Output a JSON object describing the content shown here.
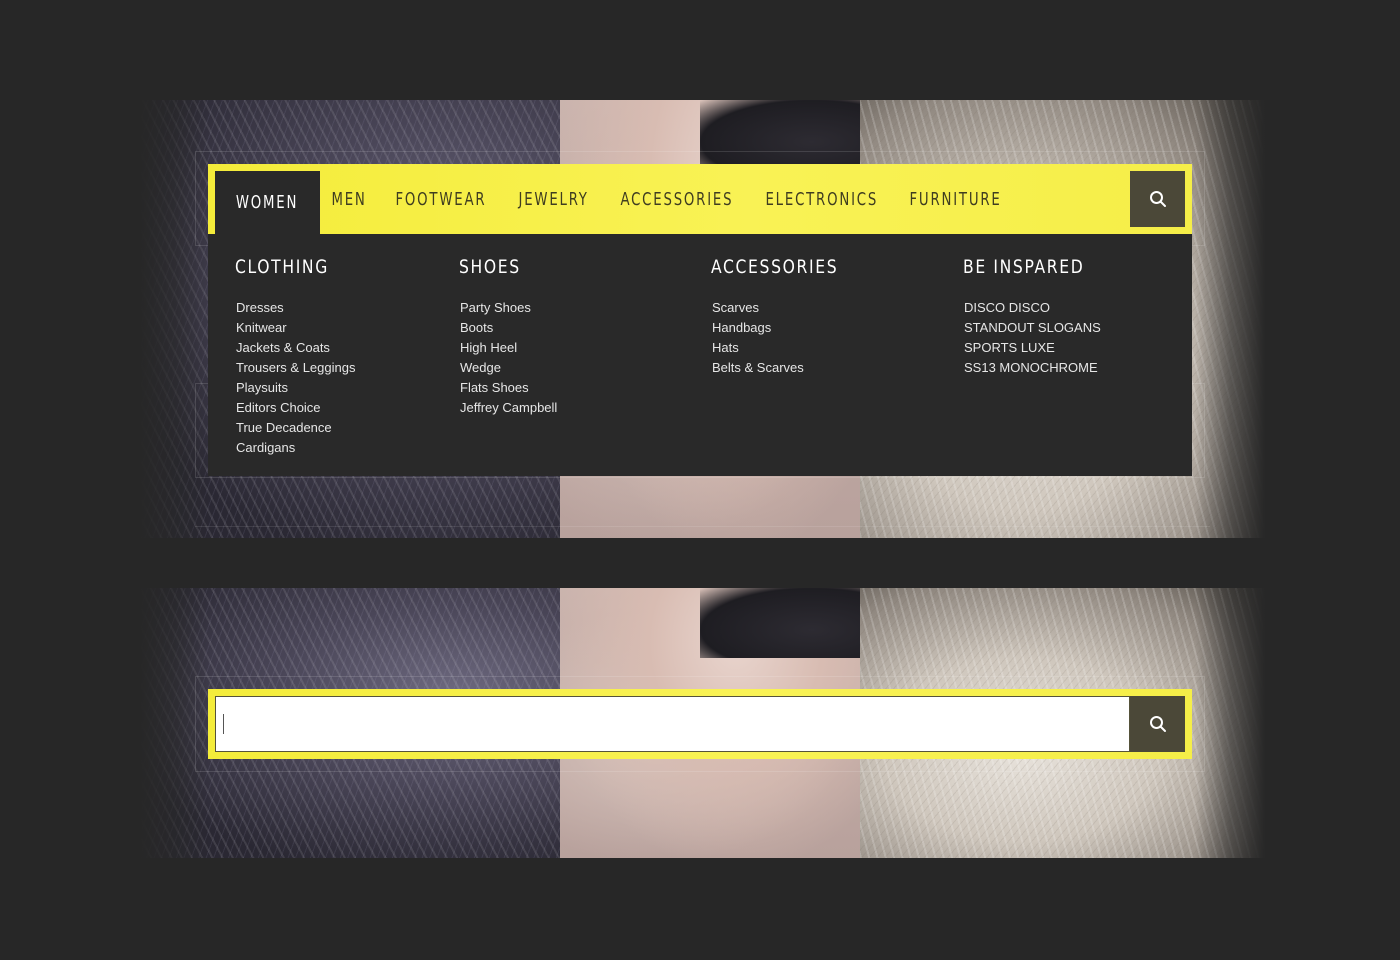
{
  "nav": {
    "items": [
      {
        "label": "WOMEN",
        "active": true
      },
      {
        "label": "MEN",
        "active": false
      },
      {
        "label": "FOOTWEAR",
        "active": false
      },
      {
        "label": "JEWELRY",
        "active": false
      },
      {
        "label": "ACCESSORIES",
        "active": false
      },
      {
        "label": "ELECTRONICS",
        "active": false
      },
      {
        "label": "FURNITURE",
        "active": false
      }
    ],
    "search_icon": "search-icon"
  },
  "dropdown": {
    "columns": [
      {
        "heading": "CLOTHING",
        "links": [
          "Dresses",
          "Knitwear",
          "Jackets & Coats",
          "Trousers & Leggings",
          "Playsuits",
          "Editors Choice",
          "True Decadence",
          "Cardigans"
        ]
      },
      {
        "heading": "SHOES",
        "links": [
          "Party Shoes",
          "Boots",
          "High Heel",
          "Wedge",
          "Flats Shoes",
          "Jeffrey Campbell"
        ]
      },
      {
        "heading": "ACCESSORIES",
        "links": [
          "Scarves",
          "Handbags",
          "Hats",
          "Belts & Scarves"
        ]
      },
      {
        "heading": "BE INSPARED",
        "links": [
          "DISCO DISCO",
          "STANDOUT SLOGANS",
          "SPORTS LUXE",
          "SS13 MONOCHROME"
        ]
      }
    ]
  },
  "search": {
    "value": "",
    "placeholder": ""
  },
  "colors": {
    "accent_yellow": "#f7ef45",
    "dark_panel": "#292929",
    "search_button": "#4b4838",
    "page_background": "#272727"
  }
}
